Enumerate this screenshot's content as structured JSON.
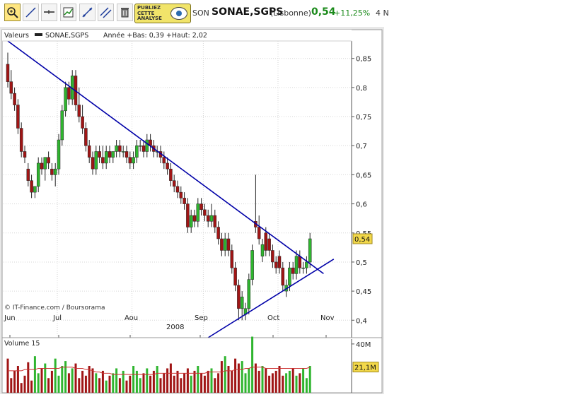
{
  "toolbar": {
    "tools": [
      "zoom-in-tool",
      "line-tool",
      "horizontal-line-tool",
      "chart-type-tool",
      "diagonal-tool",
      "parallel-tool",
      "trash-tool"
    ],
    "ad_text": "PUBLIEZ\nCETTE\nANALYSE",
    "ticker": "SON",
    "name": "SONAE,SGPS",
    "exchange": "(Lisbonne)",
    "price": "0,54",
    "change": "+11,25%",
    "date": "4 N"
  },
  "colors": {
    "up": "#2fb52f",
    "down": "#a01515",
    "trendline": "#0000a8",
    "volume_ma": "#cc3333",
    "price_tag": "#f2d84a"
  },
  "chart_data": [
    {
      "type": "candlestick",
      "legend": {
        "header": "Valeurs",
        "series": "SONAE,SGPS",
        "info": "Année +Bas: 0,39 +Haut: 2,02"
      },
      "source": "© IT-Finance.com / Boursorama",
      "x_ticks": [
        "Jun",
        "Jul",
        "Aou",
        "Sep",
        "Oct",
        "Nov"
      ],
      "x_year": "2008",
      "y_ticks": [
        "0,4",
        "0,45",
        "0,5",
        "0,55",
        "0,6",
        "0,65",
        "0,7",
        "0,75",
        "0,8",
        "0,85"
      ],
      "ylim": [
        0.37,
        0.88
      ],
      "last_price": "0,54",
      "grid": true,
      "candles": [
        [
          0.84,
          0.86,
          0.8,
          0.81
        ],
        [
          0.81,
          0.83,
          0.78,
          0.79
        ],
        [
          0.79,
          0.8,
          0.76,
          0.77
        ],
        [
          0.77,
          0.78,
          0.72,
          0.73
        ],
        [
          0.73,
          0.74,
          0.68,
          0.69
        ],
        [
          0.69,
          0.7,
          0.67,
          0.68
        ],
        [
          0.66,
          0.67,
          0.63,
          0.64
        ],
        [
          0.64,
          0.65,
          0.61,
          0.62
        ],
        [
          0.62,
          0.63,
          0.61,
          0.63
        ],
        [
          0.63,
          0.68,
          0.62,
          0.67
        ],
        [
          0.67,
          0.68,
          0.65,
          0.66
        ],
        [
          0.66,
          0.68,
          0.64,
          0.68
        ],
        [
          0.68,
          0.69,
          0.66,
          0.67
        ],
        [
          0.66,
          0.67,
          0.64,
          0.65
        ],
        [
          0.65,
          0.67,
          0.63,
          0.66
        ],
        [
          0.66,
          0.72,
          0.65,
          0.71
        ],
        [
          0.71,
          0.77,
          0.7,
          0.76
        ],
        [
          0.76,
          0.81,
          0.75,
          0.8
        ],
        [
          0.8,
          0.81,
          0.77,
          0.78
        ],
        [
          0.78,
          0.83,
          0.77,
          0.82
        ],
        [
          0.82,
          0.83,
          0.76,
          0.77
        ],
        [
          0.77,
          0.8,
          0.74,
          0.75
        ],
        [
          0.75,
          0.77,
          0.72,
          0.73
        ],
        [
          0.73,
          0.74,
          0.69,
          0.7
        ],
        [
          0.7,
          0.71,
          0.67,
          0.68
        ],
        [
          0.68,
          0.69,
          0.65,
          0.66
        ],
        [
          0.66,
          0.7,
          0.65,
          0.69
        ],
        [
          0.69,
          0.7,
          0.67,
          0.68
        ],
        [
          0.68,
          0.7,
          0.66,
          0.67
        ],
        [
          0.67,
          0.7,
          0.66,
          0.69
        ],
        [
          0.69,
          0.7,
          0.67,
          0.68
        ],
        [
          0.68,
          0.69,
          0.67,
          0.69
        ],
        [
          0.69,
          0.71,
          0.68,
          0.7
        ],
        [
          0.7,
          0.71,
          0.68,
          0.69
        ],
        [
          0.69,
          0.7,
          0.68,
          0.69
        ],
        [
          0.69,
          0.7,
          0.67,
          0.68
        ],
        [
          0.68,
          0.69,
          0.66,
          0.67
        ],
        [
          0.67,
          0.69,
          0.66,
          0.68
        ],
        [
          0.68,
          0.71,
          0.67,
          0.7
        ],
        [
          0.7,
          0.71,
          0.69,
          0.7
        ],
        [
          0.7,
          0.71,
          0.68,
          0.69
        ],
        [
          0.69,
          0.72,
          0.68,
          0.71
        ],
        [
          0.71,
          0.72,
          0.69,
          0.7
        ],
        [
          0.7,
          0.71,
          0.68,
          0.69
        ],
        [
          0.69,
          0.7,
          0.68,
          0.69
        ],
        [
          0.69,
          0.7,
          0.67,
          0.68
        ],
        [
          0.68,
          0.69,
          0.66,
          0.67
        ],
        [
          0.67,
          0.68,
          0.65,
          0.66
        ],
        [
          0.66,
          0.67,
          0.63,
          0.64
        ],
        [
          0.64,
          0.65,
          0.62,
          0.63
        ],
        [
          0.63,
          0.64,
          0.61,
          0.62
        ],
        [
          0.62,
          0.63,
          0.6,
          0.61
        ],
        [
          0.61,
          0.62,
          0.59,
          0.6
        ],
        [
          0.6,
          0.61,
          0.55,
          0.56
        ],
        [
          0.56,
          0.59,
          0.55,
          0.58
        ],
        [
          0.58,
          0.59,
          0.56,
          0.57
        ],
        [
          0.57,
          0.61,
          0.56,
          0.6
        ],
        [
          0.6,
          0.61,
          0.58,
          0.59
        ],
        [
          0.59,
          0.6,
          0.57,
          0.58
        ],
        [
          0.58,
          0.59,
          0.56,
          0.57
        ],
        [
          0.57,
          0.6,
          0.56,
          0.58
        ],
        [
          0.58,
          0.59,
          0.55,
          0.56
        ],
        [
          0.56,
          0.57,
          0.53,
          0.54
        ],
        [
          0.54,
          0.55,
          0.51,
          0.52
        ],
        [
          0.52,
          0.55,
          0.51,
          0.54
        ],
        [
          0.54,
          0.55,
          0.51,
          0.52
        ],
        [
          0.52,
          0.53,
          0.48,
          0.49
        ],
        [
          0.49,
          0.5,
          0.45,
          0.46
        ],
        [
          0.46,
          0.47,
          0.4,
          0.42
        ],
        [
          0.42,
          0.45,
          0.4,
          0.44
        ],
        [
          0.41,
          0.43,
          0.4,
          0.42
        ],
        [
          0.42,
          0.48,
          0.41,
          0.47
        ],
        [
          0.47,
          0.53,
          0.46,
          0.52
        ],
        [
          0.57,
          0.65,
          0.55,
          0.56
        ],
        [
          0.56,
          0.58,
          0.53,
          0.54
        ],
        [
          0.51,
          0.54,
          0.5,
          0.53
        ],
        [
          0.55,
          0.56,
          0.51,
          0.52
        ],
        [
          0.54,
          0.55,
          0.51,
          0.52
        ],
        [
          0.52,
          0.53,
          0.49,
          0.5
        ],
        [
          0.5,
          0.51,
          0.48,
          0.49
        ],
        [
          0.51,
          0.52,
          0.48,
          0.49
        ],
        [
          0.49,
          0.5,
          0.45,
          0.46
        ],
        [
          0.45,
          0.47,
          0.44,
          0.46
        ],
        [
          0.46,
          0.5,
          0.45,
          0.49
        ],
        [
          0.49,
          0.5,
          0.47,
          0.48
        ],
        [
          0.48,
          0.52,
          0.47,
          0.51
        ],
        [
          0.51,
          0.52,
          0.48,
          0.49
        ],
        [
          0.49,
          0.5,
          0.48,
          0.49
        ],
        [
          0.49,
          0.51,
          0.48,
          0.5
        ],
        [
          0.5,
          0.55,
          0.49,
          0.54
        ]
      ],
      "trendlines": [
        {
          "from": [
            0,
            0.88
          ],
          "to": [
            93,
            0.48
          ]
        },
        {
          "from": [
            59,
            0.37
          ],
          "to": [
            96,
            0.505
          ]
        }
      ]
    },
    {
      "type": "bar",
      "title": "Volume 15",
      "y_ticks": [
        "40M"
      ],
      "ylim": [
        0,
        44
      ],
      "last_value": "21,1M",
      "values": [
        28,
        12,
        18,
        22,
        8,
        14,
        25,
        10,
        30,
        16,
        20,
        24,
        12,
        18,
        28,
        14,
        22,
        26,
        16,
        20,
        24,
        12,
        18,
        14,
        22,
        20,
        16,
        12,
        18,
        10,
        14,
        16,
        20,
        12,
        18,
        10,
        14,
        22,
        18,
        12,
        16,
        20,
        14,
        18,
        22,
        12,
        16,
        20,
        24,
        14,
        18,
        12,
        16,
        20,
        14,
        18,
        22,
        16,
        14,
        18,
        20,
        12,
        16,
        26,
        30,
        22,
        18,
        28,
        24,
        26,
        16,
        20,
        46,
        24,
        18,
        22,
        20,
        14,
        16,
        18,
        22,
        14,
        16,
        18,
        20,
        14,
        16,
        20,
        12,
        22
      ],
      "ma": [
        18,
        18,
        18,
        18,
        18,
        19,
        19,
        19,
        19,
        20,
        20,
        20,
        20,
        20,
        20,
        20,
        21,
        21,
        21,
        21,
        20,
        20,
        20,
        19,
        19,
        18,
        17,
        17,
        16,
        16,
        16,
        15,
        15,
        15,
        15,
        15,
        15,
        15,
        15,
        15,
        15,
        15,
        15,
        15,
        16,
        16,
        16,
        16,
        16,
        16,
        16,
        16,
        16,
        16,
        16,
        16,
        16,
        16,
        16,
        17,
        17,
        17,
        17,
        17,
        18,
        18,
        18,
        19,
        19,
        19,
        20,
        20,
        21,
        21,
        21,
        21,
        20,
        20,
        20,
        20,
        20,
        20,
        20,
        20,
        20,
        20,
        20,
        20,
        20,
        21
      ]
    }
  ]
}
